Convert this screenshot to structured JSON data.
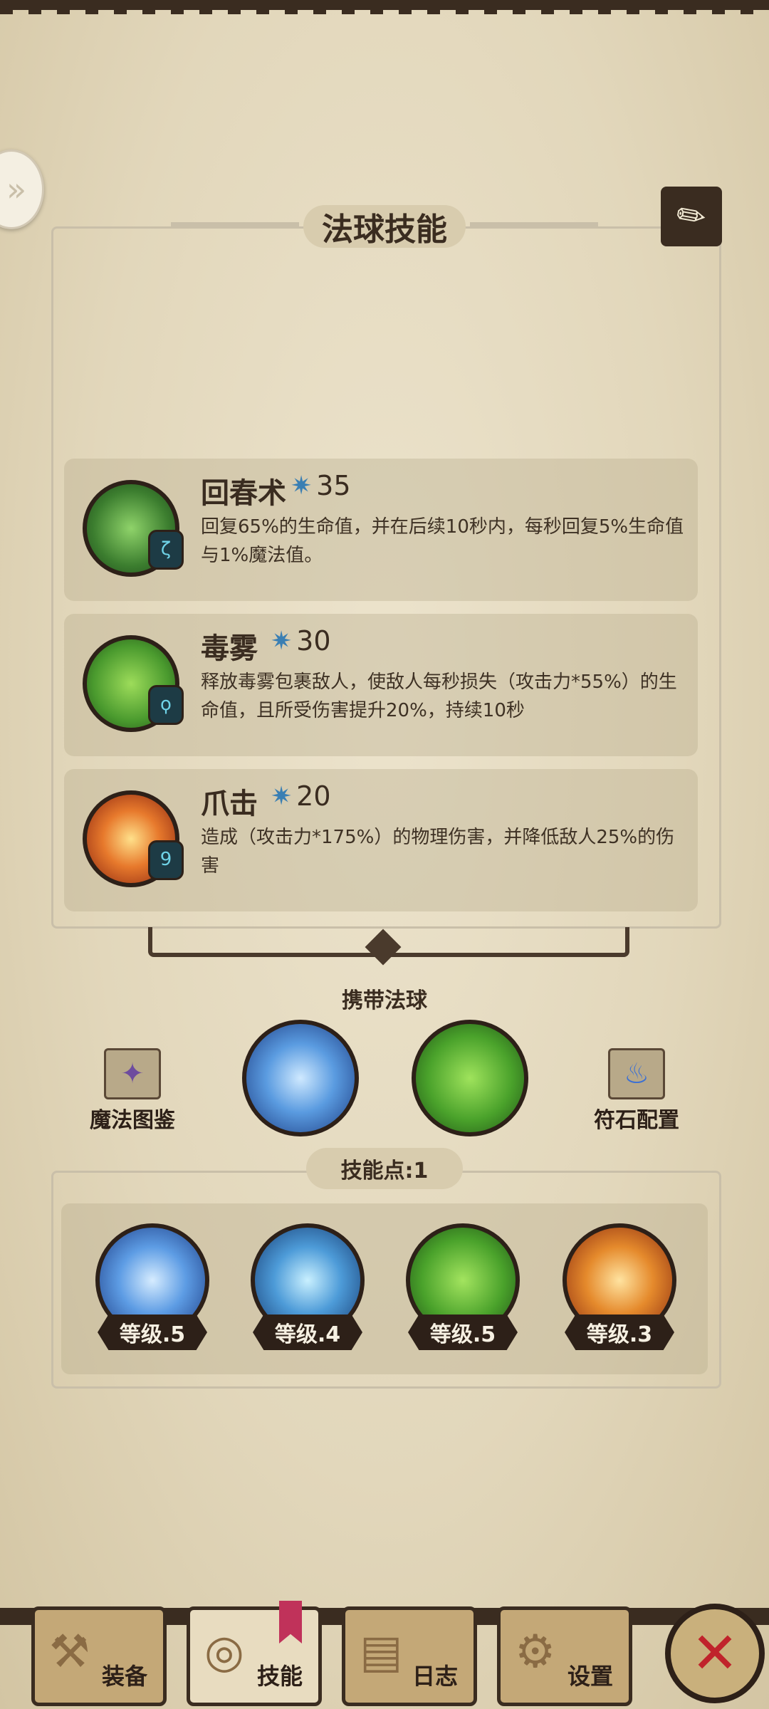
{
  "header": {
    "title": "法球技能"
  },
  "skills": [
    {
      "name": "回春术",
      "cost": "35",
      "desc": "回复65%的生命值，并在后续10秒内，每秒回复5%生命值与1%魔法值。",
      "gem": "ζ"
    },
    {
      "name": "毒雾",
      "cost": "30",
      "desc": "释放毒雾包裹敌人，使敌人每秒损失（攻击力*55%）的生命值，且所受伤害提升20%，持续10秒",
      "gem": "ϙ"
    },
    {
      "name": "爪击",
      "cost": "20",
      "desc": "造成（攻击力*175%）的物理伤害，并降低敌人25%的伤害",
      "gem": "9"
    }
  ],
  "carry": {
    "label": "携带法球"
  },
  "side_buttons": {
    "left": "魔法图鉴",
    "right": "符石配置"
  },
  "skill_points": {
    "label": "技能点:1"
  },
  "orbs": [
    {
      "level": "等级.5",
      "icon": "ice-crystal-orb"
    },
    {
      "level": "等级.4",
      "icon": "lightning-ice-orb"
    },
    {
      "level": "等级.5",
      "icon": "nature-orb"
    },
    {
      "level": "等级.3",
      "icon": "fire-vortex-orb"
    }
  ],
  "tabs": [
    {
      "label": "装备",
      "icon": "axe-icon"
    },
    {
      "label": "技能",
      "icon": "skill-ring-icon"
    },
    {
      "label": "日志",
      "icon": "scroll-icon"
    },
    {
      "label": "设置",
      "icon": "gear-icon"
    }
  ],
  "colors": {
    "accent_red": "#c0232b",
    "parchment": "#e2d7bb",
    "ink": "#3a2c20"
  }
}
